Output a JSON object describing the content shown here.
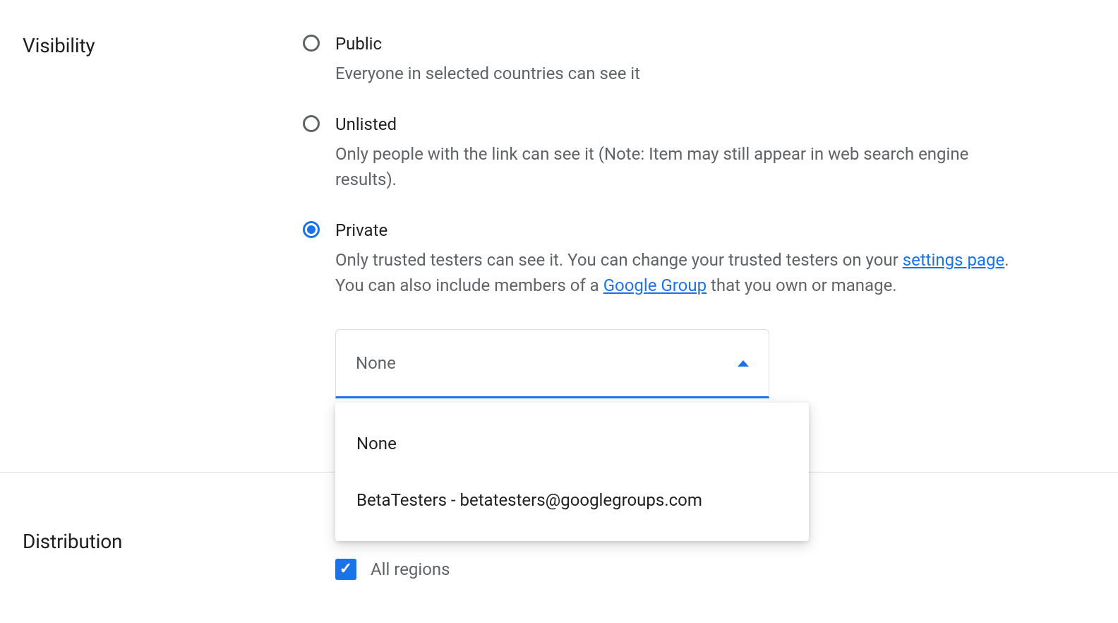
{
  "visibility": {
    "label": "Visibility",
    "options": [
      {
        "title": "Public",
        "desc": "Everyone in selected countries can see it",
        "selected": false
      },
      {
        "title": "Unlisted",
        "desc": "Only people with the link can see it (Note: Item may still appear in web search engine results).",
        "selected": false
      },
      {
        "title": "Private",
        "desc_prefix": "Only trusted testers can see it. You can change your trusted testers on your ",
        "settings_link": "settings page",
        "desc_mid": ".",
        "desc_line2_prefix": "You can also include members of a ",
        "group_link": "Google Group",
        "desc_line2_suffix": " that you own or manage.",
        "selected": true
      }
    ],
    "group_select": {
      "value": "None",
      "options": [
        "None",
        "BetaTesters - betatesters@googlegroups.com"
      ]
    }
  },
  "distribution": {
    "label": "Distribution",
    "all_regions_label": "All regions",
    "all_regions_checked": true
  }
}
